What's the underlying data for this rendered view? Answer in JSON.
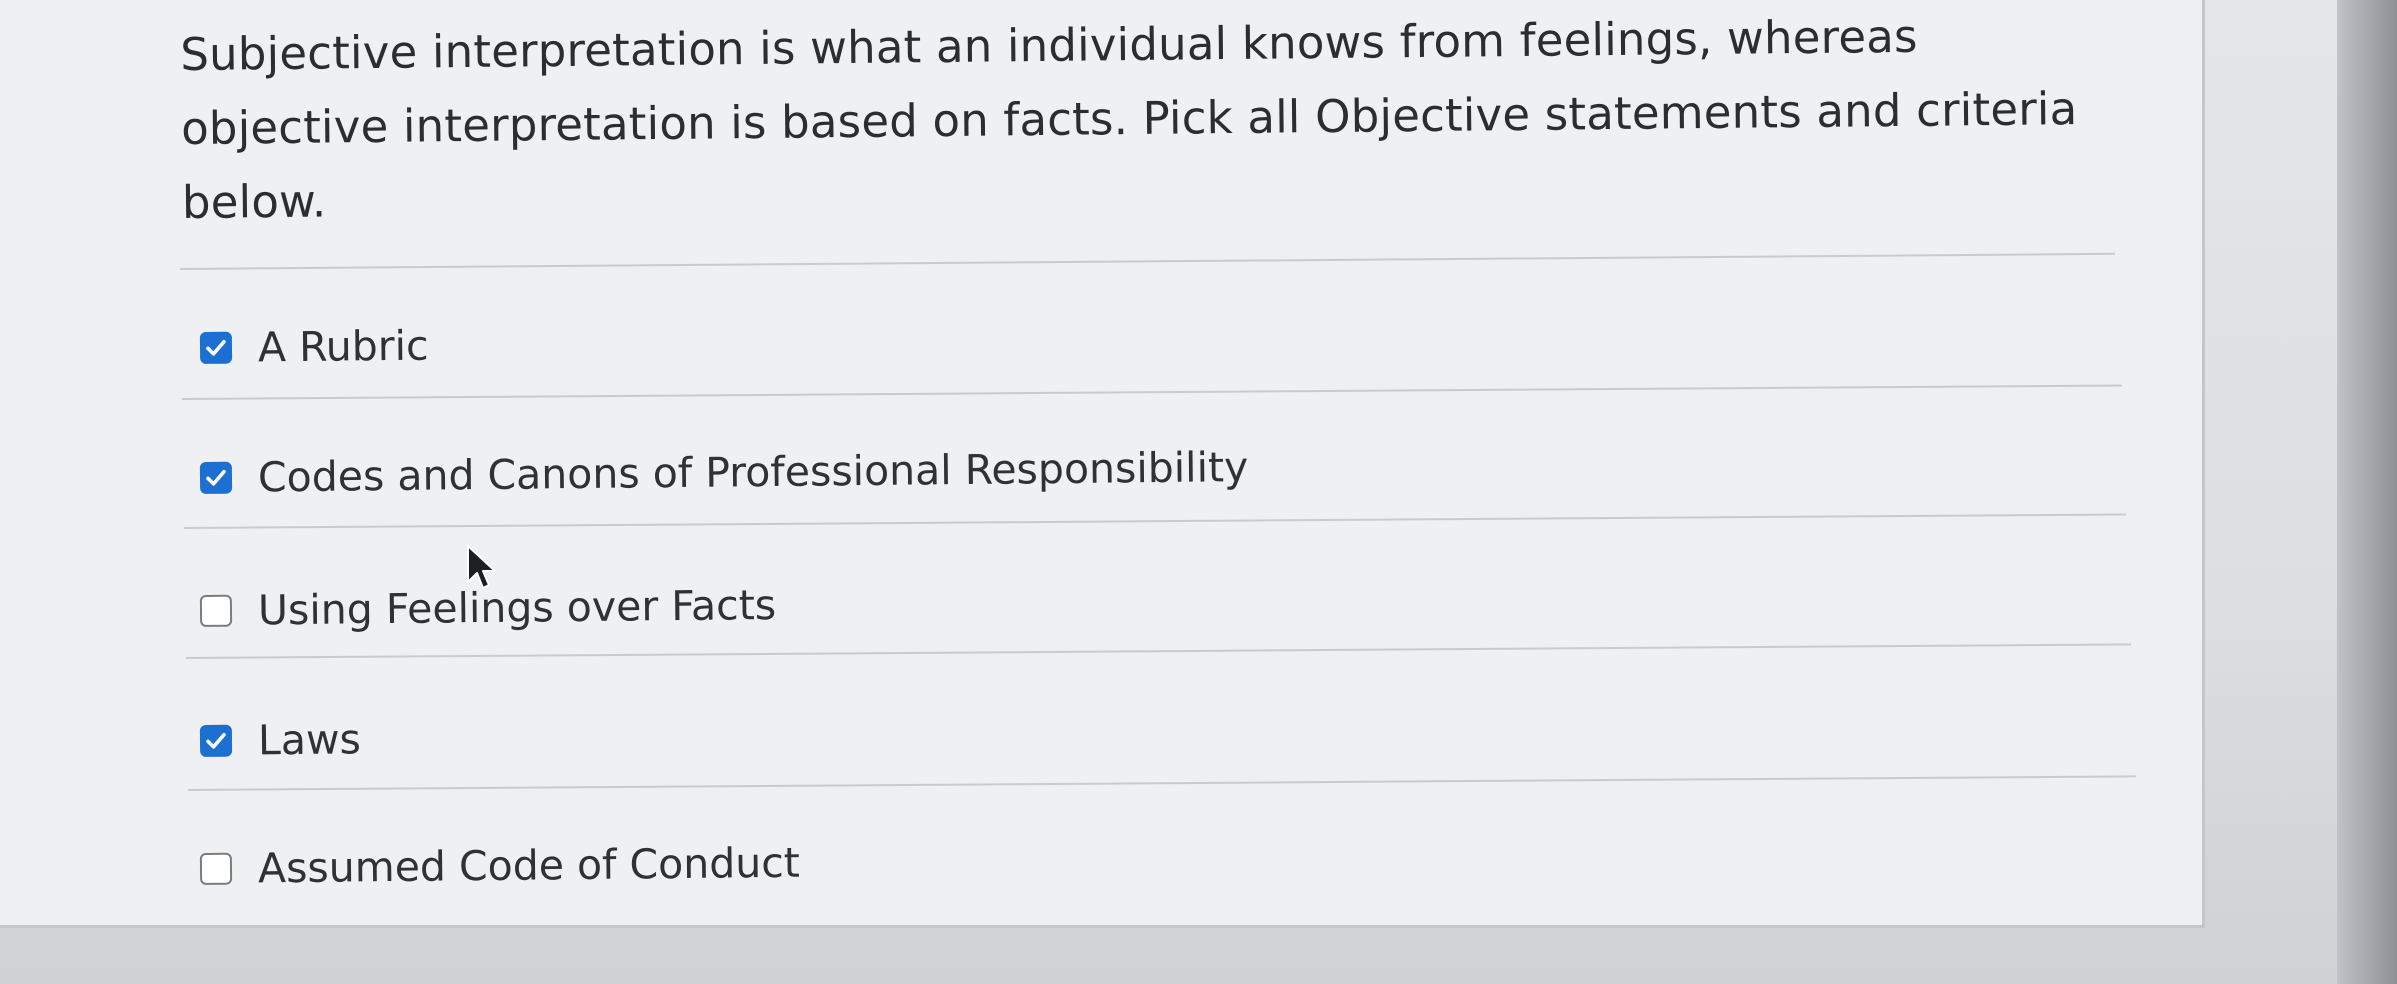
{
  "question": {
    "text": "Subjective interpretation is what an individual knows from feelings, whereas objective interpretation is based on facts.   Pick all Objective statements and criteria below."
  },
  "options": [
    {
      "label": "A Rubric",
      "checked": true
    },
    {
      "label": "Codes and Canons of Professional Responsibility",
      "checked": true
    },
    {
      "label": "Using Feelings over Facts",
      "checked": false
    },
    {
      "label": "Laws",
      "checked": true
    },
    {
      "label": "Assumed Code of Conduct",
      "checked": false
    }
  ],
  "colors": {
    "checkbox_checked": "#1d6fd1",
    "checkbox_unchecked_border": "#7a7d80",
    "text": "#2b2d2f"
  },
  "icons": {
    "checked": "checkmark-icon",
    "pointer": "mouse-pointer-icon"
  }
}
